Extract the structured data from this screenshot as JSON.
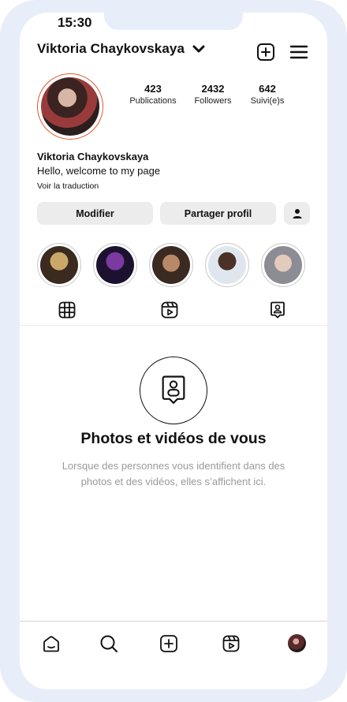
{
  "status_bar": {
    "time": "15:30"
  },
  "header": {
    "username": "Viktoria Chaykovskaya",
    "icons": [
      "chevron-down-icon",
      "add-post-icon",
      "menu-icon"
    ]
  },
  "profile": {
    "stats": {
      "posts": {
        "count": "423",
        "label": "Publications"
      },
      "followers": {
        "count": "2432",
        "label": "Followers"
      },
      "following": {
        "count": "642",
        "label": "Suivi(e)s"
      }
    },
    "display_name": "Viktoria Chaykovskaya",
    "bio": "Hello, welcome to my page",
    "translate_link": "Voir la traduction",
    "avatar_ring_color": "#e8542f"
  },
  "actions": {
    "edit_label": "Modifier",
    "share_label": "Partager profil",
    "suggest_icon": "person-icon"
  },
  "highlights": [
    {
      "name": "highlight-1",
      "colors": [
        "#c9a86a",
        "#3b2a1f"
      ]
    },
    {
      "name": "highlight-2",
      "colors": [
        "#7a3aa0",
        "#1c1230"
      ]
    },
    {
      "name": "highlight-3",
      "colors": [
        "#b88868",
        "#3a2a22"
      ]
    },
    {
      "name": "highlight-4",
      "colors": [
        "#4a3326",
        "#dfe6ee"
      ]
    },
    {
      "name": "highlight-5",
      "colors": [
        "#e3cbbc",
        "#8c8c94"
      ]
    }
  ],
  "tabs": [
    {
      "name": "grid",
      "icon": "grid-icon"
    },
    {
      "name": "reels",
      "icon": "reels-icon"
    },
    {
      "name": "tagged",
      "icon": "tagged-icon",
      "active": true
    }
  ],
  "empty_state": {
    "icon": "tagged-icon",
    "title": "Photos et vidéos de vous",
    "description": "Lorsque des personnes vous identifient dans des photos et des vidéos, elles s’affichent ici."
  },
  "bottom_nav": [
    {
      "name": "home",
      "icon": "home-icon"
    },
    {
      "name": "search",
      "icon": "search-icon"
    },
    {
      "name": "create",
      "icon": "add-post-icon"
    },
    {
      "name": "reels",
      "icon": "reels-icon"
    },
    {
      "name": "profile",
      "icon": "avatar"
    }
  ]
}
